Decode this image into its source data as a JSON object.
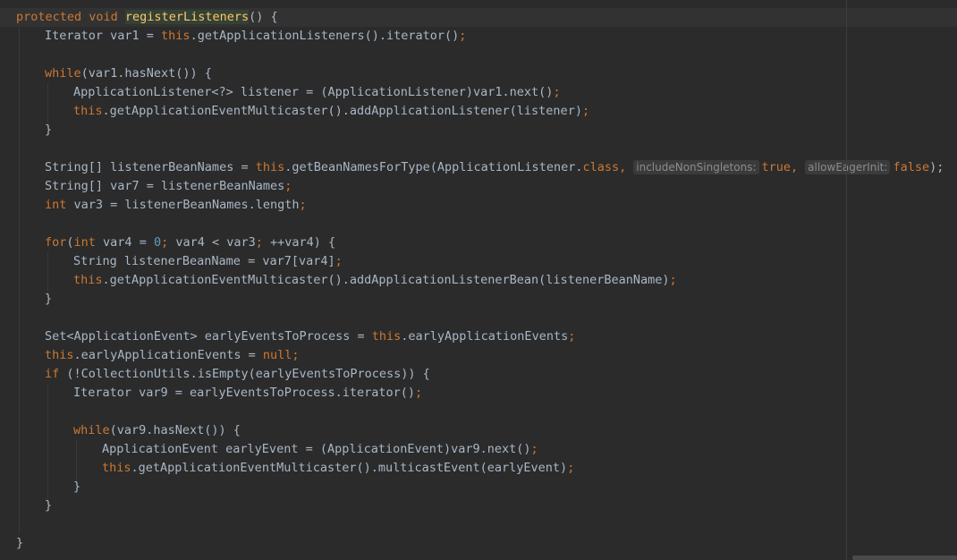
{
  "editor": {
    "lines": [
      {
        "indent": 0,
        "tokens": [
          {
            "t": "protected void ",
            "c": "kw"
          },
          {
            "t": "registerListeners",
            "c": "hl-fn"
          },
          {
            "t": "() {",
            "c": "plain"
          }
        ]
      },
      {
        "indent": 1,
        "tokens": [
          {
            "t": "Iterator var1 = ",
            "c": "plain"
          },
          {
            "t": "this",
            "c": "kw"
          },
          {
            "t": ".getApplicationListeners().iterator()",
            "c": "plain"
          },
          {
            "t": ";",
            "c": "kw"
          }
        ]
      },
      {
        "indent": 0,
        "tokens": []
      },
      {
        "indent": 1,
        "tokens": [
          {
            "t": "while",
            "c": "kw"
          },
          {
            "t": "(var1.hasNext()) {",
            "c": "plain"
          }
        ]
      },
      {
        "indent": 2,
        "tokens": [
          {
            "t": "ApplicationListener<?> listener = (ApplicationListener)var1.next()",
            "c": "plain"
          },
          {
            "t": ";",
            "c": "kw"
          }
        ]
      },
      {
        "indent": 2,
        "tokens": [
          {
            "t": "this",
            "c": "kw"
          },
          {
            "t": ".getApplicationEventMulticaster().addApplicationListener(listener)",
            "c": "plain"
          },
          {
            "t": ";",
            "c": "kw"
          }
        ]
      },
      {
        "indent": 1,
        "tokens": [
          {
            "t": "}",
            "c": "plain"
          }
        ]
      },
      {
        "indent": 0,
        "tokens": []
      },
      {
        "indent": 1,
        "tokens": [
          {
            "t": "String[] listenerBeanNames = ",
            "c": "plain"
          },
          {
            "t": "this",
            "c": "kw"
          },
          {
            "t": ".getBeanNamesForType(ApplicationListener.",
            "c": "plain"
          },
          {
            "t": "class",
            "c": "kw"
          },
          {
            "t": ",",
            "c": "kw"
          },
          {
            "t": "includeNonSingletons:",
            "c": "hint"
          },
          {
            "t": "true",
            "c": "kw"
          },
          {
            "t": ",",
            "c": "kw"
          },
          {
            "t": "allowEagerInit:",
            "c": "hint"
          },
          {
            "t": "false",
            "c": "kw"
          },
          {
            "t": ");",
            "c": "plain"
          }
        ]
      },
      {
        "indent": 1,
        "tokens": [
          {
            "t": "String[] var7 = listenerBeanNames",
            "c": "plain"
          },
          {
            "t": ";",
            "c": "kw"
          }
        ]
      },
      {
        "indent": 1,
        "tokens": [
          {
            "t": "int",
            "c": "kw"
          },
          {
            "t": " var3 = listenerBeanNames.length",
            "c": "plain"
          },
          {
            "t": ";",
            "c": "kw"
          }
        ]
      },
      {
        "indent": 0,
        "tokens": []
      },
      {
        "indent": 1,
        "tokens": [
          {
            "t": "for",
            "c": "kw"
          },
          {
            "t": "(",
            "c": "plain"
          },
          {
            "t": "int",
            "c": "kw"
          },
          {
            "t": " var4 = ",
            "c": "plain"
          },
          {
            "t": "0",
            "c": "num"
          },
          {
            "t": "; ",
            "c": "kw"
          },
          {
            "t": "var4 < var3",
            "c": "plain"
          },
          {
            "t": "; ",
            "c": "kw"
          },
          {
            "t": "++var4) {",
            "c": "plain"
          }
        ]
      },
      {
        "indent": 2,
        "tokens": [
          {
            "t": "String listenerBeanName = var7[var4]",
            "c": "plain"
          },
          {
            "t": ";",
            "c": "kw"
          }
        ]
      },
      {
        "indent": 2,
        "tokens": [
          {
            "t": "this",
            "c": "kw"
          },
          {
            "t": ".getApplicationEventMulticaster().addApplicationListenerBean(listenerBeanName)",
            "c": "plain"
          },
          {
            "t": ";",
            "c": "kw"
          }
        ]
      },
      {
        "indent": 1,
        "tokens": [
          {
            "t": "}",
            "c": "plain"
          }
        ]
      },
      {
        "indent": 0,
        "tokens": []
      },
      {
        "indent": 1,
        "tokens": [
          {
            "t": "Set<ApplicationEvent> earlyEventsToProcess = ",
            "c": "plain"
          },
          {
            "t": "this",
            "c": "kw"
          },
          {
            "t": ".earlyApplicationEvents",
            "c": "plain"
          },
          {
            "t": ";",
            "c": "kw"
          }
        ]
      },
      {
        "indent": 1,
        "tokens": [
          {
            "t": "this",
            "c": "kw"
          },
          {
            "t": ".earlyApplicationEvents = ",
            "c": "plain"
          },
          {
            "t": "null",
            "c": "kw"
          },
          {
            "t": ";",
            "c": "kw"
          }
        ]
      },
      {
        "indent": 1,
        "tokens": [
          {
            "t": "if",
            "c": "kw"
          },
          {
            "t": " (!CollectionUtils.isEmpty(earlyEventsToProcess)) {",
            "c": "plain"
          }
        ]
      },
      {
        "indent": 2,
        "tokens": [
          {
            "t": "Iterator var9 = earlyEventsToProcess.iterator()",
            "c": "plain"
          },
          {
            "t": ";",
            "c": "kw"
          }
        ]
      },
      {
        "indent": 0,
        "tokens": []
      },
      {
        "indent": 2,
        "tokens": [
          {
            "t": "while",
            "c": "kw"
          },
          {
            "t": "(var9.hasNext()) {",
            "c": "plain"
          }
        ]
      },
      {
        "indent": 3,
        "tokens": [
          {
            "t": "ApplicationEvent earlyEvent = (ApplicationEvent)var9.next()",
            "c": "plain"
          },
          {
            "t": ";",
            "c": "kw"
          }
        ]
      },
      {
        "indent": 3,
        "tokens": [
          {
            "t": "this",
            "c": "kw"
          },
          {
            "t": ".getApplicationEventMulticaster().multicastEvent(earlyEvent)",
            "c": "plain"
          },
          {
            "t": ";",
            "c": "kw"
          }
        ]
      },
      {
        "indent": 2,
        "tokens": [
          {
            "t": "}",
            "c": "plain"
          }
        ]
      },
      {
        "indent": 1,
        "tokens": [
          {
            "t": "}",
            "c": "plain"
          }
        ]
      },
      {
        "indent": 0,
        "tokens": []
      },
      {
        "indent": 0,
        "tokens": [
          {
            "t": "}",
            "c": "plain"
          }
        ]
      }
    ]
  },
  "colors": {
    "background": "#2b2b2b",
    "keyword": "#cc7832",
    "method": "#ffc66d",
    "text": "#a9b7c6",
    "number": "#6897bb",
    "hint": "#8c8c8c"
  }
}
